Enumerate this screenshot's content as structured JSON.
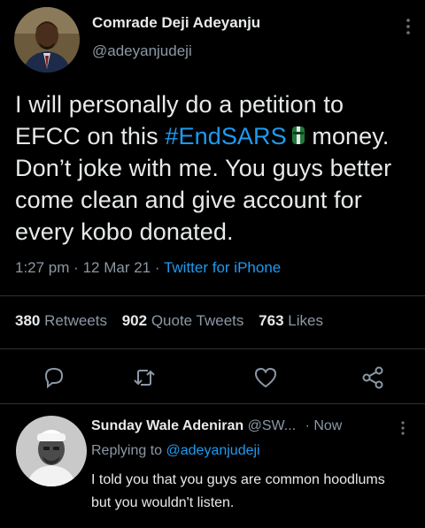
{
  "tweet": {
    "author_name": "Comrade Deji Adeyanju",
    "author_handle": "@adeyanjudeji",
    "text_before": "I will personally do a petition to EFCC on this ",
    "hashtag": "#EndSARS",
    "text_after": " money. Don’t joke with me. You guys better come clean and give account for every kobo donated.",
    "time": "1:27 pm",
    "date": "12 Mar 21",
    "separator": "·",
    "source": "Twitter for iPhone"
  },
  "stats": {
    "retweets_count": "380",
    "retweets_label": "Retweets",
    "quote_count": "902",
    "quote_label": "Quote Tweets",
    "likes_count": "763",
    "likes_label": "Likes"
  },
  "actions": [
    "reply-icon",
    "retweet-icon",
    "like-icon",
    "share-icon"
  ],
  "reply": {
    "author_name": "Sunday Wale Adeniran",
    "author_handle": "@SW...",
    "time": "Now",
    "replying_prefix": "Replying to",
    "replying_to": "@adeyanjudeji",
    "text": "I told you that you guys are common hoodlums but you wouldn't listen."
  },
  "colors": {
    "accent": "#1d9bf0",
    "muted": "#8b98a5",
    "background": "#000000",
    "text": "#e7e9ea"
  }
}
